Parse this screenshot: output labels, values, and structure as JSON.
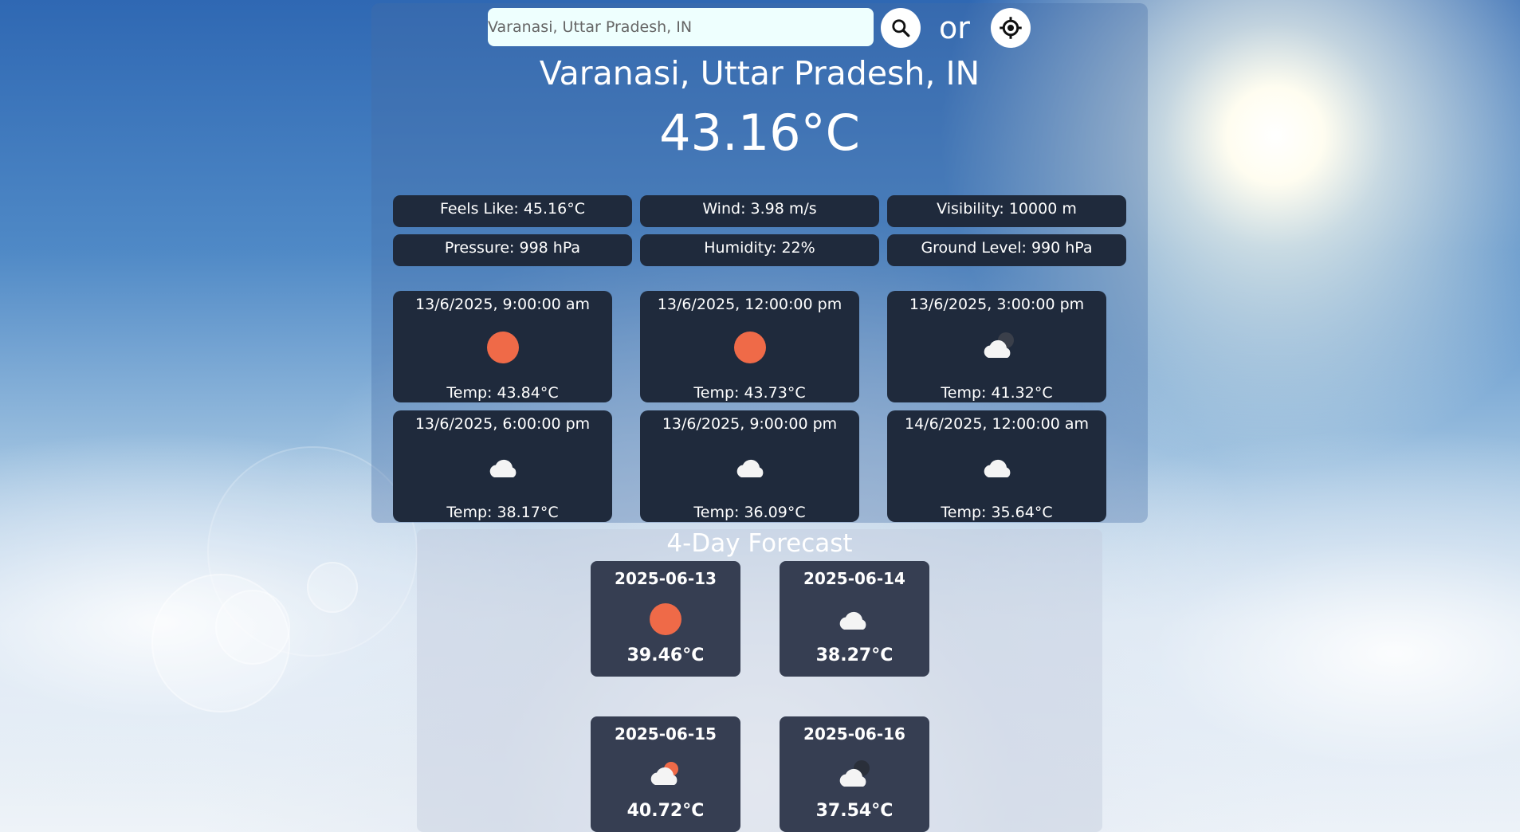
{
  "search": {
    "placeholder": "Varanasi, Uttar Pradesh, IN",
    "or_label": "or",
    "search_icon": "magnifier-icon",
    "location_icon": "crosshair-location-icon"
  },
  "current": {
    "city": "Varanasi, Uttar Pradesh, IN",
    "temperature": "43.16°C"
  },
  "stats": [
    {
      "label": "Feels Like: 45.16°C"
    },
    {
      "label": "Wind: 3.98 m/s"
    },
    {
      "label": "Visibility: 10000 m"
    },
    {
      "label": "Pressure: 998 hPa"
    },
    {
      "label": "Humidity: 22%"
    },
    {
      "label": "Ground Level: 990 hPa"
    }
  ],
  "hourly": [
    {
      "time": "13/6/2025, 9:00:00 am",
      "temp": "Temp: 43.84°C",
      "icon": "sun-icon"
    },
    {
      "time": "13/6/2025, 12:00:00 pm",
      "temp": "Temp: 43.73°C",
      "icon": "sun-icon"
    },
    {
      "time": "13/6/2025, 3:00:00 pm",
      "temp": "Temp: 41.32°C",
      "icon": "cloud-night-icon"
    },
    {
      "time": "13/6/2025, 6:00:00 pm",
      "temp": "Temp: 38.17°C",
      "icon": "cloud-icon"
    },
    {
      "time": "13/6/2025, 9:00:00 pm",
      "temp": "Temp: 36.09°C",
      "icon": "cloud-icon"
    },
    {
      "time": "14/6/2025, 12:00:00 am",
      "temp": "Temp: 35.64°C",
      "icon": "cloud-icon"
    }
  ],
  "forecast": {
    "title": "4-Day Forecast",
    "days": [
      {
        "date": "2025-06-13",
        "temp": "39.46°C",
        "icon": "sun-icon"
      },
      {
        "date": "2025-06-14",
        "temp": "38.27°C",
        "icon": "cloud-icon"
      },
      {
        "date": "2025-06-15",
        "temp": "40.72°C",
        "icon": "cloud-sun-icon"
      },
      {
        "date": "2025-06-16",
        "temp": "37.54°C",
        "icon": "cloud-night-icon"
      }
    ]
  },
  "colors": {
    "card_dark": "#1f2a3c",
    "forecast_card": "#363e52",
    "sun": "#ef6a48",
    "input_bg": "#eefffe"
  }
}
